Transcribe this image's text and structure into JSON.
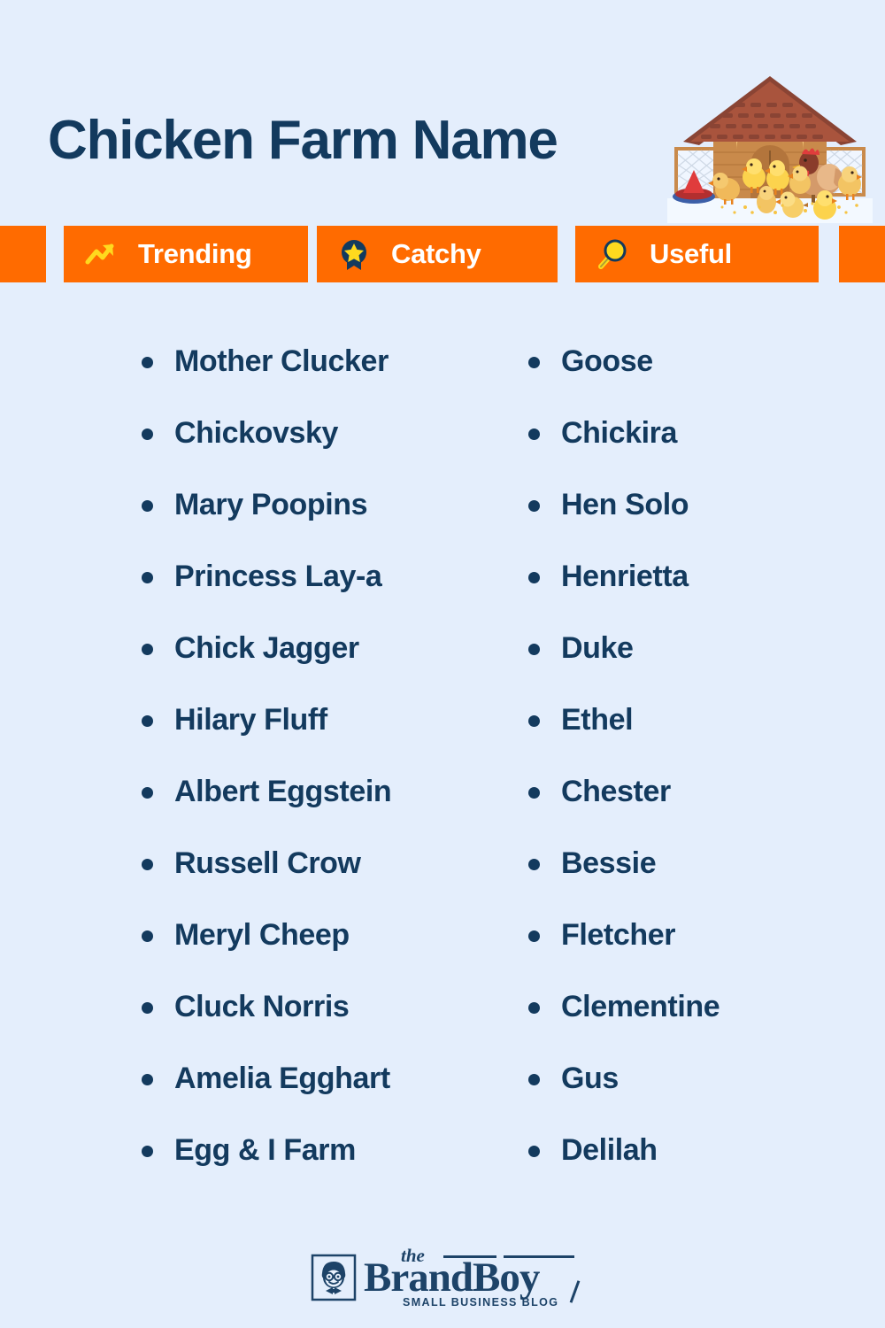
{
  "theme": {
    "background": "#e4eefc",
    "navy": "#133a5e",
    "orange": "#ff6b00",
    "yellow": "#ffd91e",
    "white": "#ffffff",
    "logo_navy": "#1d4368"
  },
  "header": {
    "title": "Chicken Farm Name",
    "illustration_name": "chicken-coop-with-hen-and-chicks"
  },
  "badges": [
    {
      "label": "Trending",
      "icon": "trending-up-arrow-icon"
    },
    {
      "label": "Catchy",
      "icon": "award-ribbon-star-icon"
    },
    {
      "label": "Useful",
      "icon": "magnifying-glass-icon"
    }
  ],
  "lists": {
    "left": [
      "Mother Clucker",
      "Chickovsky",
      "Mary Poopins",
      "Princess Lay-a",
      "Chick Jagger",
      "Hilary Fluff",
      "Albert Eggstein",
      "Russell Crow",
      "Meryl Cheep",
      "Cluck Norris",
      "Amelia Egghart",
      "Egg & I Farm"
    ],
    "right": [
      "Goose",
      "Chickira",
      "Hen Solo",
      "Henrietta",
      "Duke",
      "Ethel",
      "Chester",
      "Bessie",
      "Fletcher",
      "Clementine",
      "Gus",
      "Delilah"
    ]
  },
  "footer": {
    "logo_the": "the",
    "logo_brand": "BrandBoy",
    "logo_tagline": "SMALL BUSINESS BLOG",
    "logo_mark_name": "brandboy-face-icon"
  }
}
